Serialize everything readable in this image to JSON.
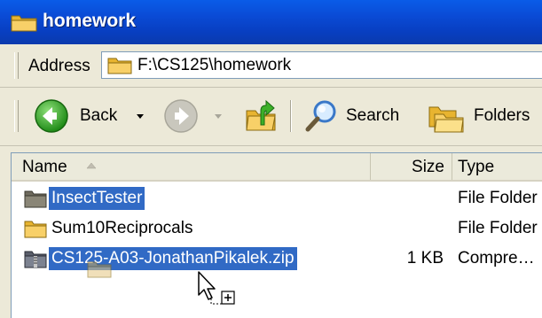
{
  "window": {
    "title": "homework"
  },
  "address": {
    "label": "Address",
    "value": "F:\\CS125\\homework"
  },
  "toolbar": {
    "back_label": "Back",
    "search_label": "Search",
    "folders_label": "Folders"
  },
  "columns": {
    "name": "Name",
    "size": "Size",
    "type": "Type"
  },
  "files": [
    {
      "name": "InsectTester",
      "size": "",
      "type": "File Folder",
      "icon": "folder-icon"
    },
    {
      "name": "Sum10Reciprocals",
      "size": "",
      "type": "File Folder",
      "icon": "folder-icon"
    },
    {
      "name": "CS125-A03-JonathanPikalek.zip",
      "size": "1 KB",
      "type": "Compre…",
      "icon": "zip-file-icon"
    }
  ],
  "colors": {
    "titlebar": "#0a4bd6",
    "selection": "#316ac5",
    "toolbar_bg": "#ece9d8"
  }
}
